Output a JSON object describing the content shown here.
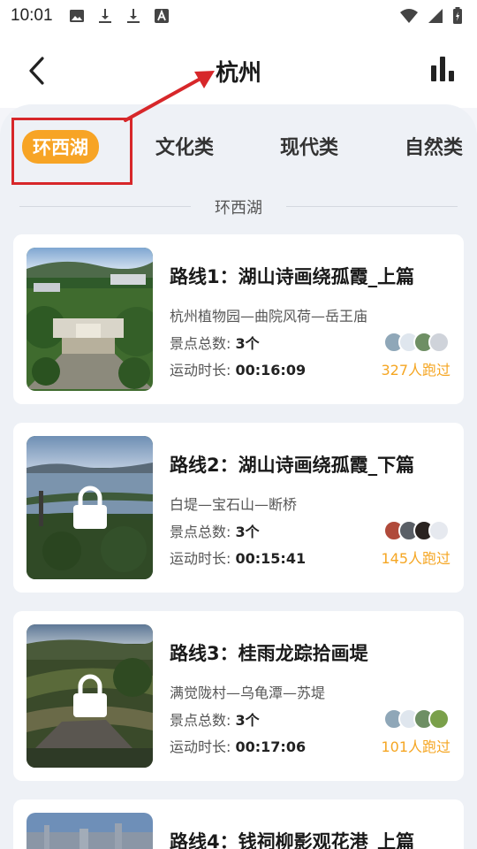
{
  "status_bar": {
    "time": "10:01",
    "left_icons": [
      "image-icon",
      "download-icon",
      "download-icon",
      "font-a-icon"
    ],
    "right_icons": [
      "wifi-icon",
      "signal-icon",
      "battery-charging-icon"
    ]
  },
  "header": {
    "title": "杭州",
    "back_icon": "chevron-left-icon",
    "stats_icon": "bar-chart-icon"
  },
  "tabs": [
    {
      "label": "环西湖",
      "active": true
    },
    {
      "label": "文化类",
      "active": false
    },
    {
      "label": "现代类",
      "active": false
    },
    {
      "label": "自然类",
      "active": false
    }
  ],
  "section_title": "环西湖",
  "routes": [
    {
      "title": "路线1：湖山诗画绕孤霞_上篇",
      "path": "杭州植物园—曲院风荷—岳王庙",
      "spots_label": "景点总数:",
      "spots_value": "3个",
      "duration_label": "运动时长:",
      "duration_value": "00:16:09",
      "runs": "327人跑过",
      "locked": false
    },
    {
      "title": "路线2：湖山诗画绕孤霞_下篇",
      "path": "白堤—宝石山—断桥",
      "spots_label": "景点总数:",
      "spots_value": "3个",
      "duration_label": "运动时长:",
      "duration_value": "00:15:41",
      "runs": "145人跑过",
      "locked": true
    },
    {
      "title": "路线3：桂雨龙踪拾画堤",
      "path": "满觉陇村—乌龟潭—苏堤",
      "spots_label": "景点总数:",
      "spots_value": "3个",
      "duration_label": "运动时长:",
      "duration_value": "00:17:06",
      "runs": "101人跑过",
      "locked": true
    },
    {
      "title": "路线4：钱祠柳影观花港_上篇"
    }
  ],
  "colors": {
    "accent": "#f7a425",
    "runs_text": "#f5a623",
    "annotation": "#d7272a",
    "panel_bg": "#eef1f6"
  }
}
